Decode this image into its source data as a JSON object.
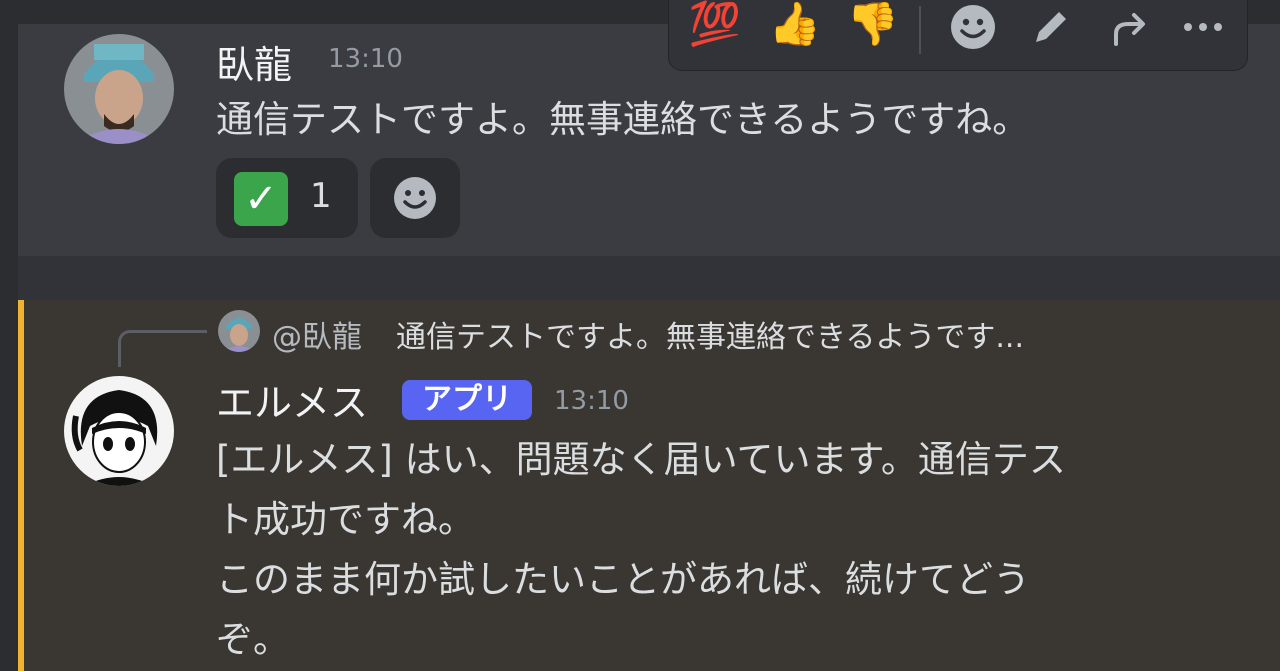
{
  "toolbar": {
    "emoji_hundred": "💯",
    "emoji_thumbs_up": "👍",
    "emoji_thumbs_down": "👎",
    "icons": [
      "hundred-points",
      "thumbs-up",
      "thumbs-down",
      "add-reaction",
      "edit",
      "forward",
      "more"
    ]
  },
  "message1": {
    "username": "臥龍",
    "timestamp": "13:10",
    "text": "通信テストですよ。無事連絡できるようですね。",
    "reactions": [
      {
        "emoji": "✓",
        "count": "1"
      }
    ]
  },
  "message2": {
    "reply": {
      "name": "@臥龍",
      "text": "通信テストですよ。無事連絡できるようです..."
    },
    "username": "エルメス",
    "badge": "アプリ",
    "timestamp": "13:10",
    "lines": [
      "[エルメス] はい、問題なく届いています。通信テス",
      "ト成功ですね。",
      "このまま何か試したいことがあれば、続けてどう",
      "ぞ。"
    ]
  },
  "colors": {
    "accent": "#f0b232",
    "badge": "#5865f2",
    "check": "#3aa54a"
  }
}
